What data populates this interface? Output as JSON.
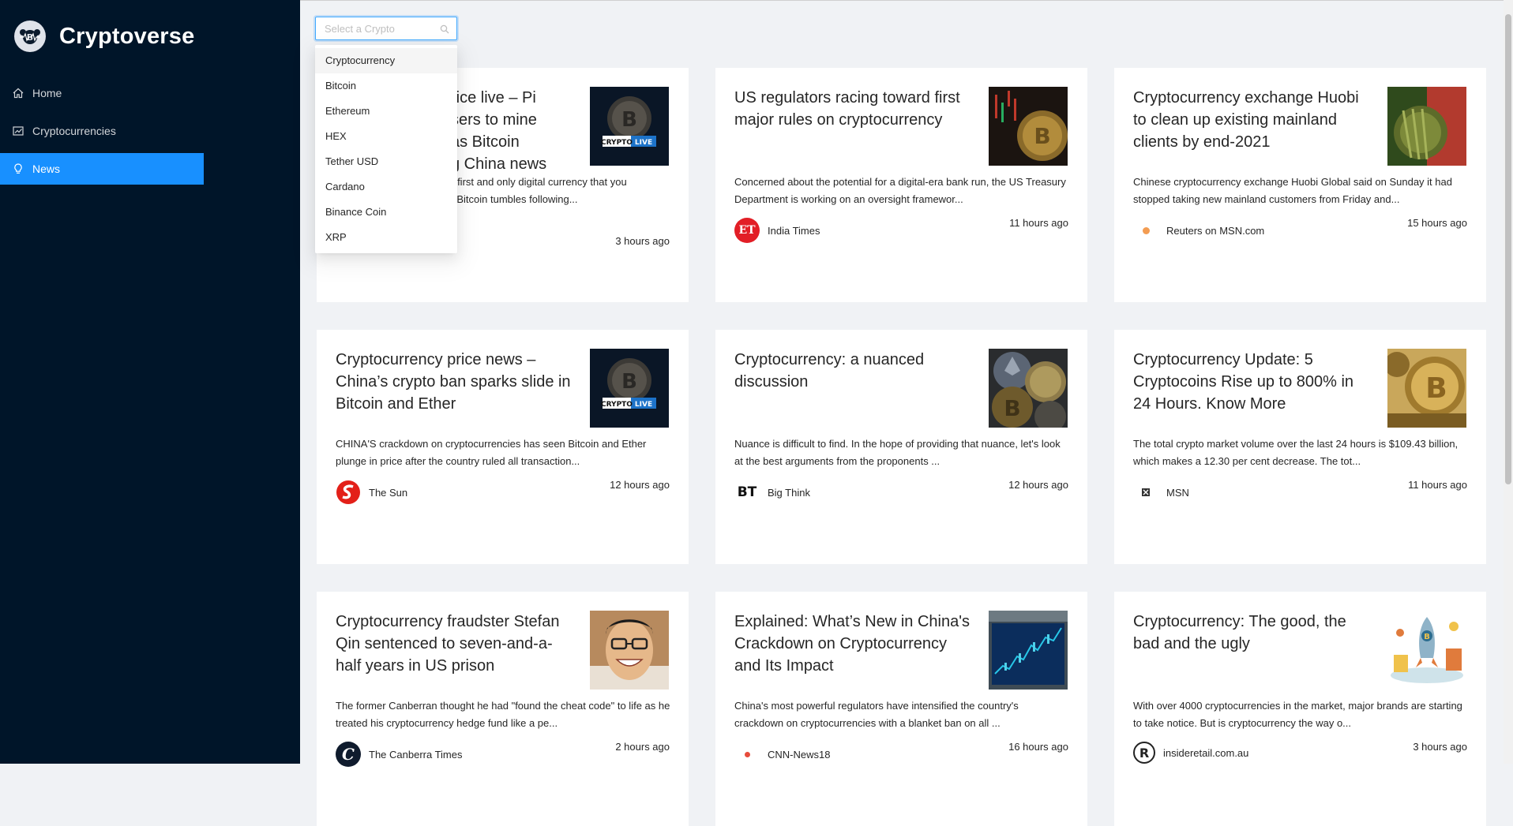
{
  "app": {
    "title": "Cryptoverse"
  },
  "sidebar": {
    "items": [
      {
        "label": "Home",
        "icon": "home-icon",
        "active": false
      },
      {
        "label": "Cryptocurrencies",
        "icon": "fund-icon",
        "active": false
      },
      {
        "label": "News",
        "icon": "bulb-icon",
        "active": true
      }
    ]
  },
  "search": {
    "placeholder": "Select a Crypto",
    "options": [
      "Cryptocurrency",
      "Bitcoin",
      "Ethereum",
      "HEX",
      "Tether USD",
      "Cardano",
      "Binance Coin",
      "XRP"
    ]
  },
  "colors": {
    "sidebar_bg": "#001529",
    "accent": "#1890ff",
    "page_bg": "#f0f2f5"
  },
  "news": [
    {
      "title": "Cryptocurrency price live – Pi Network allows users to mine digital currency as Bitcoin tumbles following China news",
      "visible_title_lines": [
        "rice live – Pi",
        "sers to mine",
        "as Bitcoin",
        "g China news"
      ],
      "description": "the first and only digital currency that you can mine as Bitcoin tumbles following...",
      "visible_desc_lines": [
        "he first and only digital currency that you",
        "as Bitcoin tumbles following..."
      ],
      "provider": "",
      "time": "3 hours ago"
    },
    {
      "title": "US regulators racing toward first major rules on cryptocurrency",
      "description": "Concerned about the potential for a digital-era bank run, the US Treasury Department is working on an oversight framewor...",
      "provider": "India Times",
      "time": "11 hours ago"
    },
    {
      "title": "Cryptocurrency exchange Huobi to clean up existing mainland clients by end-2021",
      "description": "Chinese cryptocurrency exchange Huobi Global said on Sunday it had stopped taking new mainland customers from Friday and...",
      "provider": "Reuters on MSN.com",
      "time": "15 hours ago"
    },
    {
      "title": "Cryptocurrency price news – China’s crypto ban sparks slide in Bitcoin and Ether",
      "description": "CHINA'S crackdown on cryptocurrencies has seen Bitcoin and Ether plunge in price after the country ruled all transaction...",
      "provider": "The Sun",
      "time": "12 hours ago"
    },
    {
      "title": "Cryptocurrency: a nuanced discussion",
      "description": "Nuance is difficult to find. In the hope of providing that nuance, let's look at the best arguments from the proponents ...",
      "provider": "Big Think",
      "time": "12 hours ago"
    },
    {
      "title": "Cryptocurrency Update: 5 Cryptocoins Rise up to 800% in 24 Hours. Know More",
      "description": "The total crypto market volume over the last 24 hours is $109.43 billion, which makes a 12.30 per cent decrease. The tot...",
      "provider": "MSN",
      "time": "11 hours ago"
    },
    {
      "title": "Cryptocurrency fraudster Stefan Qin sentenced to seven-and-a-half years in US prison",
      "description": "The former Canberran thought he had \"found the cheat code\" to life as he treated his cryptocurrency hedge fund like a pe...",
      "provider": "The Canberra Times",
      "time": "2 hours ago"
    },
    {
      "title": "Explained: What’s New in China's Crackdown on Cryptocurrency and Its Impact",
      "description": "China's most powerful regulators have intensified the country's crackdown on cryptocurrencies with a blanket ban on all ...",
      "provider": "CNN-News18",
      "time": "16 hours ago"
    },
    {
      "title": "Cryptocurrency: The good, the bad and the ugly",
      "description": "With over 4000 cryptocurrencies in the market, major brands are starting to take notice. But is cryptocurrency the way o...",
      "provider": "insideretail.com.au",
      "time": "3 hours ago"
    }
  ],
  "badges": {
    "crypto_live_a": "CRYPTO",
    "crypto_live_b": "LIVE",
    "et": "ET",
    "bt": "BT",
    "canberra": "C",
    "reuters": "R"
  }
}
